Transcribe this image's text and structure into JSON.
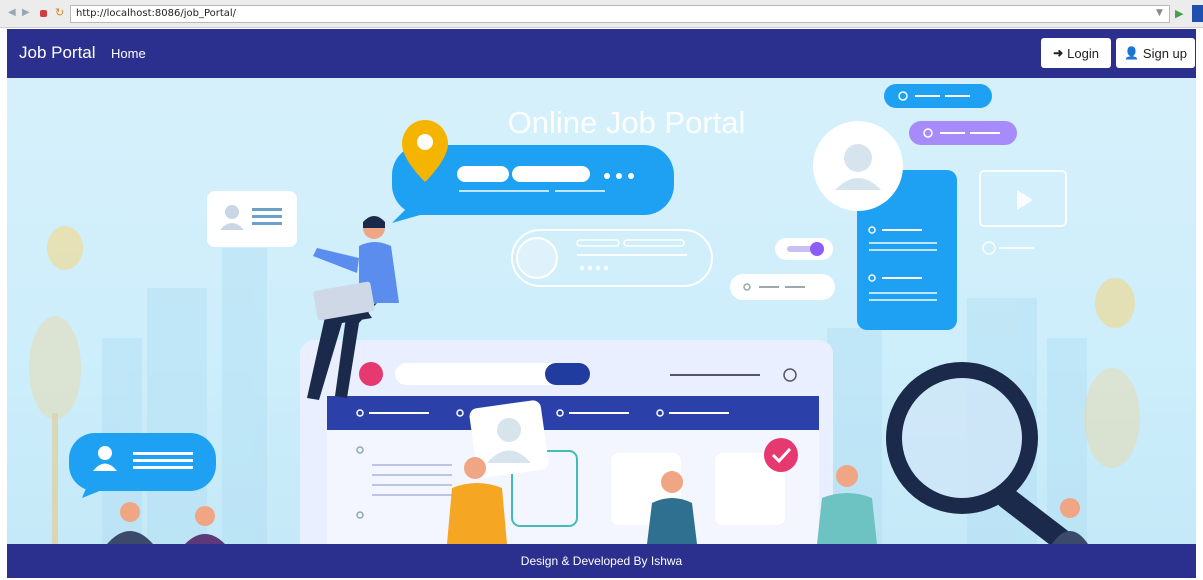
{
  "browser": {
    "url": "http://localhost:8086/job_Portal/"
  },
  "navbar": {
    "brand": "Job Portal",
    "home_label": "Home",
    "login_label": "Login",
    "signup_label": "Sign up"
  },
  "hero": {
    "title": "Online Job Portal"
  },
  "footer": {
    "credit": "Design & Developed By Ishwa"
  },
  "colors": {
    "navbar_bg": "#2b2f8e",
    "hero_bg": "#cdeefb",
    "accent_blue": "#1ea1f2",
    "accent_purple": "#a78bfa",
    "accent_pink": "#e6396f"
  },
  "icons": {
    "login": "sign-in-icon",
    "signup": "user-icon"
  }
}
